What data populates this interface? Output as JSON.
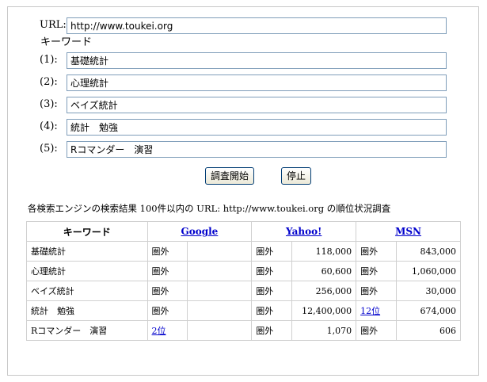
{
  "form": {
    "url_label": "URL:",
    "url_value": "http://www.toukei.org",
    "keyword_label": "キーワード",
    "keywords": [
      {
        "label": "(1):",
        "value": "基礎統計"
      },
      {
        "label": "(2):",
        "value": "心理統計"
      },
      {
        "label": "(3):",
        "value": "ベイズ統計"
      },
      {
        "label": "(4):",
        "value": "統計　勉強"
      },
      {
        "label": "(5):",
        "value": "Rコマンダー　演習"
      }
    ],
    "start_button": "調査開始",
    "stop_button": "停止"
  },
  "results": {
    "caption": "各検索エンジンの検索結果 100件以内の URL: http://www.toukei.org の順位状況調査",
    "headers": {
      "keyword": "キーワード",
      "google": "Google",
      "yahoo": "Yahoo!",
      "msn": "MSN"
    },
    "rows": [
      {
        "keyword": "基礎統計",
        "google_rank": "圏外",
        "google_count": "",
        "yahoo_rank": "圏外",
        "yahoo_count": "118,000",
        "msn_rank": "圏外",
        "msn_count": "843,000"
      },
      {
        "keyword": "心理統計",
        "google_rank": "圏外",
        "google_count": "",
        "yahoo_rank": "圏外",
        "yahoo_count": "60,600",
        "msn_rank": "圏外",
        "msn_count": "1,060,000"
      },
      {
        "keyword": "ベイズ統計",
        "google_rank": "圏外",
        "google_count": "",
        "yahoo_rank": "圏外",
        "yahoo_count": "256,000",
        "msn_rank": "圏外",
        "msn_count": "30,000"
      },
      {
        "keyword": "統計　勉強",
        "google_rank": "圏外",
        "google_count": "",
        "yahoo_rank": "圏外",
        "yahoo_count": "12,400,000",
        "msn_rank": "12位",
        "msn_count": "674,000"
      },
      {
        "keyword": "Rコマンダー　演習",
        "google_rank": "2位",
        "google_count": "",
        "yahoo_rank": "圏外",
        "yahoo_count": "1,070",
        "msn_rank": "圏外",
        "msn_count": "606"
      }
    ]
  }
}
